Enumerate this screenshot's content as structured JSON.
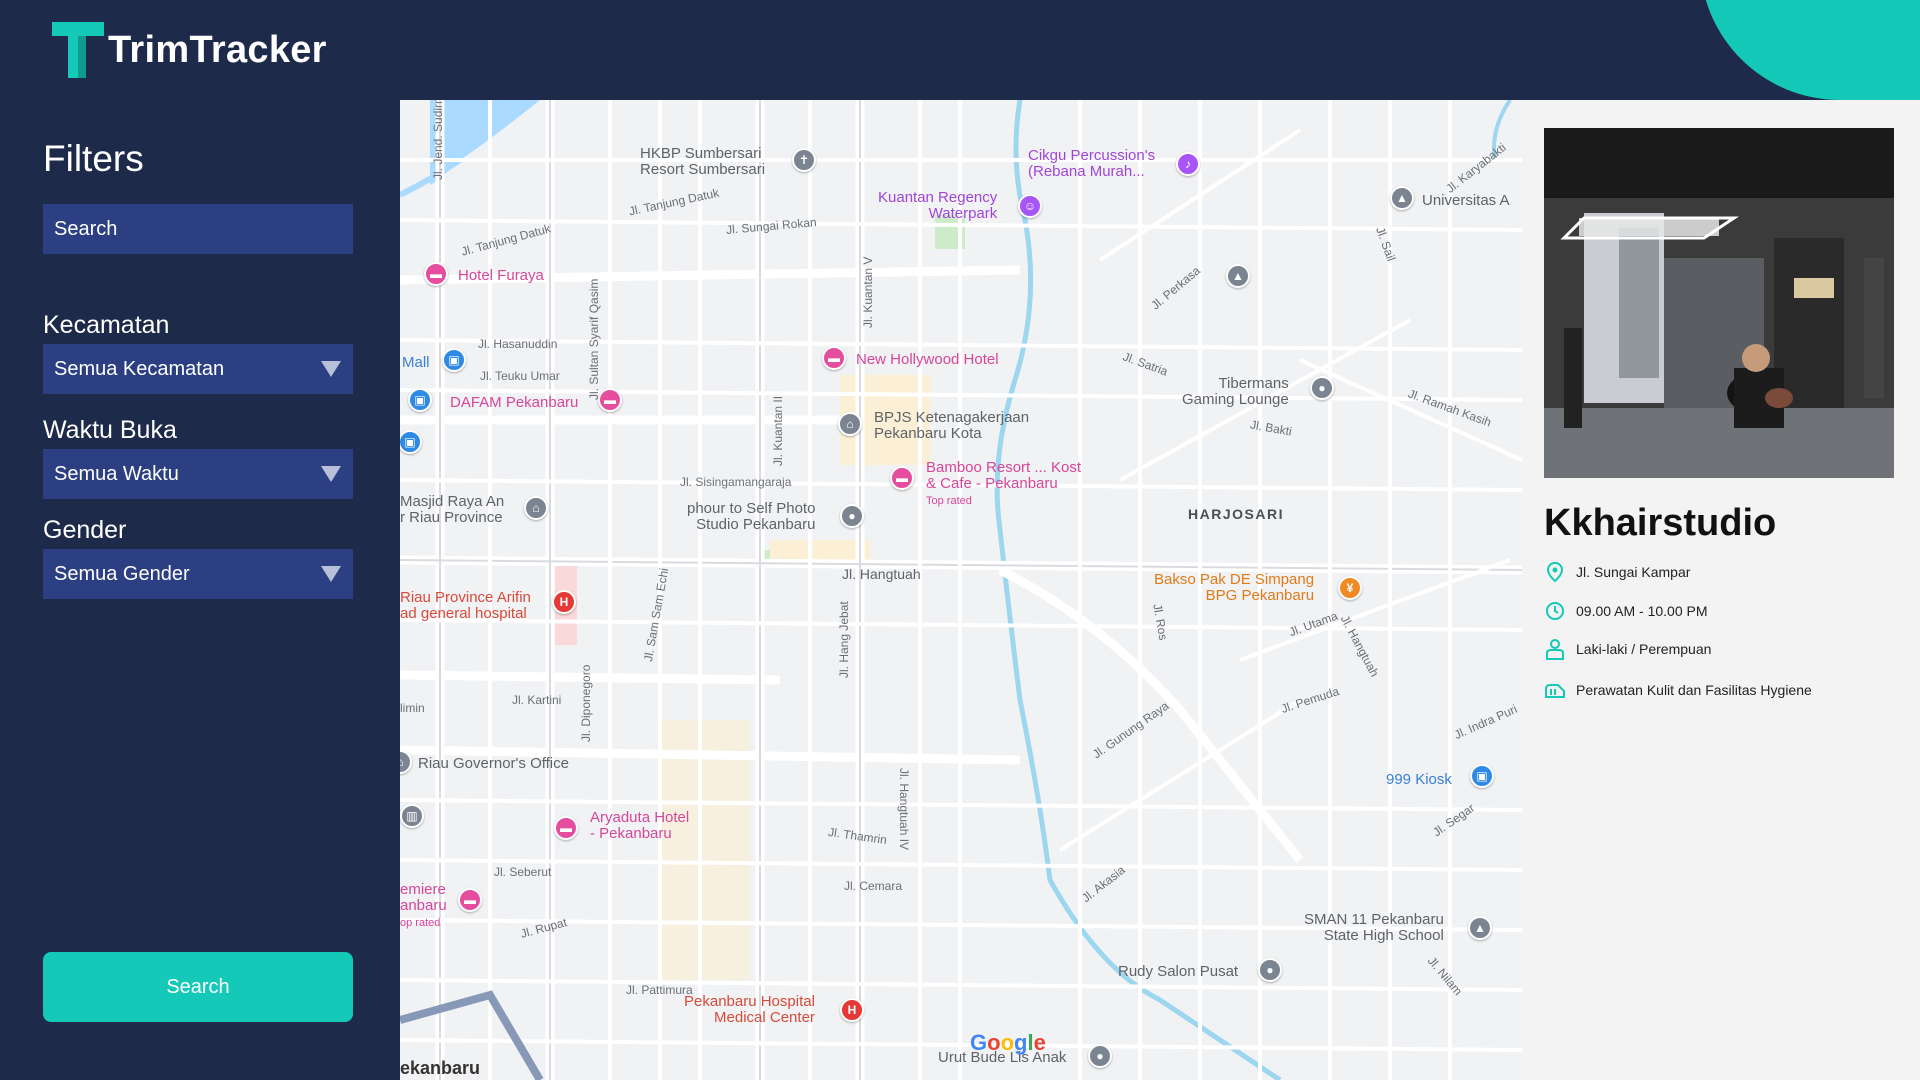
{
  "app": {
    "name": "TrimTracker"
  },
  "colors": {
    "accent": "#14c9b7",
    "sidebar_bg": "#1e2a4a",
    "field_bg": "#2c3f82"
  },
  "filters": {
    "title": "Filters",
    "search_placeholder": "Search",
    "kecamatan": {
      "label": "Kecamatan",
      "selected": "Semua Kecamatan"
    },
    "waktu_buka": {
      "label": "Waktu Buka",
      "selected": "Semua Waktu"
    },
    "gender": {
      "label": "Gender",
      "selected": "Semua Gender"
    },
    "search_button": "Search"
  },
  "map": {
    "area_label": "HARJOSARI",
    "places": [
      {
        "name": "HKBP Sumbersari Resort Sumbersari",
        "line1": "HKBP Sumbersari",
        "line2": "Resort Sumbersari"
      },
      {
        "name": "Cikgu Percussion's (Rebana Murah...",
        "line1": "Cikgu Percussion's",
        "line2": "(Rebana Murah..."
      },
      {
        "name": "Kuantan Regency Waterpark",
        "line1": "Kuantan Regency",
        "line2": "Waterpark"
      },
      {
        "name": "Universitas A",
        "line1": "Universitas A"
      },
      {
        "name": "Hotel Furaya",
        "line1": "Hotel Furaya"
      },
      {
        "name": "New Hollywood Hotel",
        "line1": "New Hollywood Hotel"
      },
      {
        "name": "Mall",
        "line1": "Mall"
      },
      {
        "name": "DAFAM Pekanbaru",
        "line1": "DAFAM Pekanbaru"
      },
      {
        "name": "Tibermans Gaming Lounge",
        "line1": "Tibermans",
        "line2": "Gaming Lounge"
      },
      {
        "name": "BPJS Ketenagakerjaan Pekanbaru Kota",
        "line1": "BPJS Ketenagakerjaan",
        "line2": "Pekanbaru Kota"
      },
      {
        "name": "Bamboo Resort ... Kost & Cafe - Pekanbaru",
        "line1": "Bamboo Resort ... Kost",
        "line2": "& Cafe - Pekanbaru",
        "line3": "Top rated"
      },
      {
        "name": "Masjid Raya An Riau Province",
        "line1": "Masjid Raya An",
        "line2": "r Riau Province"
      },
      {
        "name": "phour to Self Photo Studio Pekanbaru",
        "line1": "phour to Self Photo",
        "line2": "Studio Pekanbaru"
      },
      {
        "name": "Bakso Pak DE Simpang BPG Pekanbaru",
        "line1": "Bakso Pak DE Simpang",
        "line2": "BPG Pekanbaru"
      },
      {
        "name": "Riau Province Arifin ad general hospital",
        "line1": "Riau Province Arifin",
        "line2": "ad general hospital"
      },
      {
        "name": "Riau Governor's Office",
        "line1": "Riau Governor's Office"
      },
      {
        "name": "999 Kiosk",
        "line1": "999 Kiosk"
      },
      {
        "name": "Aryaduta Hotel - Pekanbaru",
        "line1": "Aryaduta Hotel",
        "line2": "- Pekanbaru"
      },
      {
        "name": "emiere anbaru",
        "line1": "emiere",
        "line2": "anbaru",
        "line3": "op rated"
      },
      {
        "name": "SMAN 11 Pekanbaru State High School",
        "line1": "SMAN 11 Pekanbaru",
        "line2": "State High School"
      },
      {
        "name": "Rudy Salon Pusat",
        "line1": "Rudy Salon Pusat"
      },
      {
        "name": "Pekanbaru Hospital Medical Center",
        "line1": "Pekanbaru Hospital",
        "line2": "Medical Center"
      },
      {
        "name": "Urut Bude Lis Anak",
        "line1": "Urut Bude Lis Anak"
      },
      {
        "name": "Pekanbaru",
        "line1": "ekanbaru"
      }
    ],
    "roads": [
      "Jl. Jend. Sudirman",
      "Jl. Tanjung Datuk",
      "Jl. Tanjung Datuk",
      "Jl. Sungai Rokan",
      "Jl. Hasanuddin",
      "Jl. Teuku Umar",
      "Jl. Sultan Syarif Qasim",
      "Jl. Kuantan V",
      "Jl. Perkasa",
      "Jl. Satria",
      "Jl. Sail",
      "Jl. Karyabakti",
      "Jl. Bakti",
      "Jl. Ramah Kasih",
      "Jl. Sisingamangaraja",
      "Jl. Kuantan II",
      "Jl. Hangtuah",
      "Jl. Utama",
      "Jl. Hangtuah",
      "Jl. Ros",
      "Jl. Kartini",
      "Jl. Diponegoro",
      "Jl. Sam Sam Echi",
      "Jl. Hang Jebat",
      "Jl. Hangtuah IV",
      "Jl. Gunung Raya",
      "Jl. Pemuda",
      "Jl. Indra Puri",
      "Jl. Thamrin",
      "Jl. Cemara",
      "Jl. Seberut",
      "Jl. Rupat",
      "Jl. Akasia",
      "Jl. Segar",
      "Jl. Nilam",
      "Jl. Pattimura",
      "limin"
    ],
    "attribution": "Google"
  },
  "detail": {
    "name": "Kkhairstudio",
    "address": "Jl. Sungai Kampar",
    "hours": "09.00 AM - 10.00 PM",
    "gender": "Laki-laki / Perempuan",
    "facilities": "Perawatan Kulit dan Fasilitas Hygiene"
  }
}
